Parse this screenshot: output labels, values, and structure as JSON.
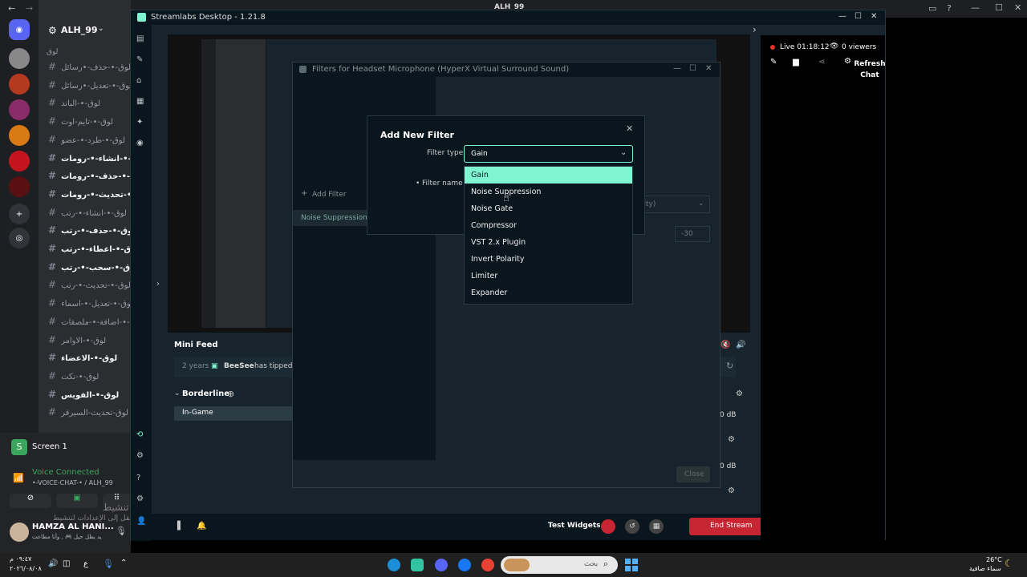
{
  "top_title": "ALH_99",
  "discord": {
    "server_name": "ALH_99",
    "category": "لوق",
    "channels": [
      {
        "name": "لوق-•-حذف-•رسائل",
        "bold": false
      },
      {
        "name": "لوق-•-تعديل-•رسائل",
        "bold": false
      },
      {
        "name": "لوق-•-الباند",
        "bold": false
      },
      {
        "name": "لوق-•-تايم-اوت",
        "bold": false
      },
      {
        "name": "لوق-•-طرد-•-عضو",
        "bold": false
      },
      {
        "name": "لوق-•-انشاء-•-رومات",
        "bold": true
      },
      {
        "name": "لوق-•-حذف-•-رومات",
        "bold": true
      },
      {
        "name": "لوق-•-تحديث-•-رومات",
        "bold": true
      },
      {
        "name": "لوق-•-انشاء-•-رتب",
        "bold": false
      },
      {
        "name": "لوق-•-حذف-•-رتب",
        "bold": true
      },
      {
        "name": "لوق-•-اعطاء-•-رتب",
        "bold": true
      },
      {
        "name": "لوق-•-سحب-•-رتب",
        "bold": true
      },
      {
        "name": "لوق-•-تحديث-•-رتب",
        "bold": false
      },
      {
        "name": "لوق-•-تعديل-•-اسماء",
        "bold": false
      },
      {
        "name": "لوق-•-اضافة-•-ملصقات",
        "bold": false
      },
      {
        "name": "لوق-•-الاوامر",
        "bold": false
      },
      {
        "name": "لوق-•-الاعضاء",
        "bold": true
      },
      {
        "name": "لوق-•-نكت",
        "bold": false
      },
      {
        "name": "لوق-•-الفويس",
        "bold": true
      },
      {
        "name": "لوق-تحديث-السيرفر",
        "bold": false
      }
    ],
    "screen_share": "Screen 1",
    "voice_status": "Voice Connected",
    "voice_channel": "•-VOICE-CHAT-• / ALH_99",
    "user_name": "HAMZA AL HANI...",
    "user_status": "يد بطل حيل 🎮 , وأنا مطاعت",
    "activation_title": "تنشيط Windows",
    "activation_sub": "انتقل إلى الإعدادات لتنشيط Windows."
  },
  "streamlabs": {
    "title": "Streamlabs Desktop - 1.21.8",
    "mini_feed_label": "Mini Feed",
    "feed_time": "2 years",
    "feed_user": "BeeSee",
    "feed_action": "has tipped",
    "scene_collection": "Borderline",
    "scene_item": "In-Game",
    "db1": "0 dB",
    "db2": "0 dB",
    "test_widgets": "Test Widgets",
    "end_stream": "End Stream",
    "live_time": "Live 01:18:12",
    "viewers": "0 viewers",
    "refresh_chat": "Refresh Chat",
    "filters_title": "Filters for Headset Microphone (HyperX Virtual Surround Sound)",
    "add_filter": "Add Filter",
    "filter_list_item": "Noise Suppression",
    "close_button": "Close",
    "bg_select_value": "lity)",
    "bg_number": "-30"
  },
  "modal": {
    "title": "Add New Filter",
    "filter_type_label": "Filter type",
    "filter_type_value": "Gain",
    "filter_name_label": "Filter name",
    "options": [
      "Gain",
      "Noise Suppression",
      "Noise Gate",
      "Compressor",
      "VST 2.x Plugin",
      "Invert Polarity",
      "Limiter",
      "Expander"
    ],
    "selected_option": 0
  },
  "taskbar": {
    "time": "٠٩:٤٧ م",
    "date": "٢٠٢٦/٠٨/٠٨",
    "lang": "ع",
    "search_placeholder": "بحث",
    "temperature": "26°C",
    "weather": "سماء صافية"
  },
  "colors": {
    "accent": "#80f5d2",
    "end_stream": "#c82532",
    "live_dot": "#e0322c"
  }
}
